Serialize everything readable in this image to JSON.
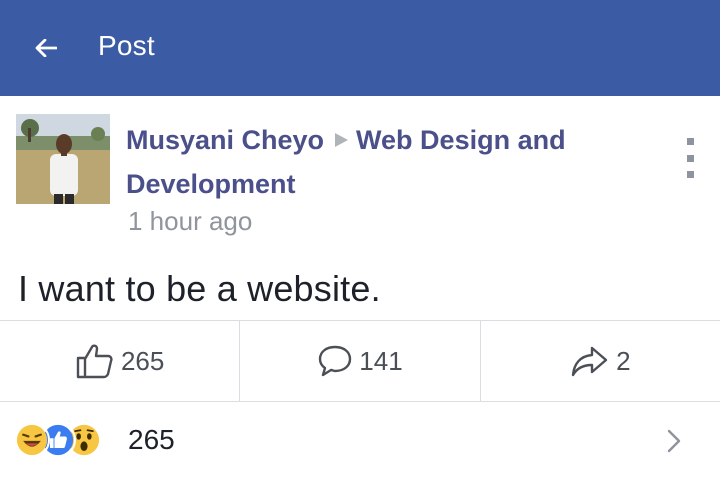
{
  "header": {
    "back_icon": "back-arrow-icon",
    "title": "Post",
    "bar_color": "#3b5ba5"
  },
  "post": {
    "author": "Musyani Cheyo",
    "group_line1": "Web Design and",
    "group_line2": "Development",
    "timestamp": "1 hour ago",
    "body": "I want to be a website."
  },
  "actions": {
    "likes": "265",
    "comments": "141",
    "shares": "2"
  },
  "reactions": {
    "icons": [
      "laugh-reaction-icon",
      "like-reaction-icon",
      "wow-reaction-icon"
    ],
    "count": "265"
  }
}
